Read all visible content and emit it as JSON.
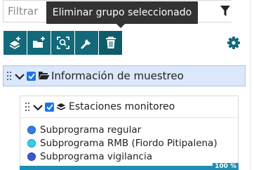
{
  "filter": {
    "placeholder": "Filtrar"
  },
  "tooltip": {
    "text": "Eliminar grupo seleccionado"
  },
  "toolbar": {
    "buttons": [
      {
        "icon": "add-layer-icon"
      },
      {
        "icon": "add-folder-icon"
      },
      {
        "icon": "zoom-to-extent-icon"
      },
      {
        "icon": "wrench-icon"
      },
      {
        "icon": "trash-icon"
      }
    ],
    "settings_icon": "gear-icon"
  },
  "group": {
    "label": "Información de muestreo",
    "checked": true,
    "expanded": true
  },
  "sublayer": {
    "label": "Estaciones monitoreo",
    "checked": true,
    "legend": [
      {
        "label": "Subprograma regular",
        "color": "#2e7ee6"
      },
      {
        "label": "Subprograma RMB (Fiordo Pitipalena)",
        "color": "#2fd0e8"
      },
      {
        "label": "Subprograma vigilancia",
        "color": "#3b57d6"
      }
    ]
  },
  "progress": {
    "label": "100 %",
    "value": 100
  },
  "colors": {
    "toolbar": "#11697a",
    "accent": "#1e73e8",
    "selection": "#dbe7fb"
  }
}
